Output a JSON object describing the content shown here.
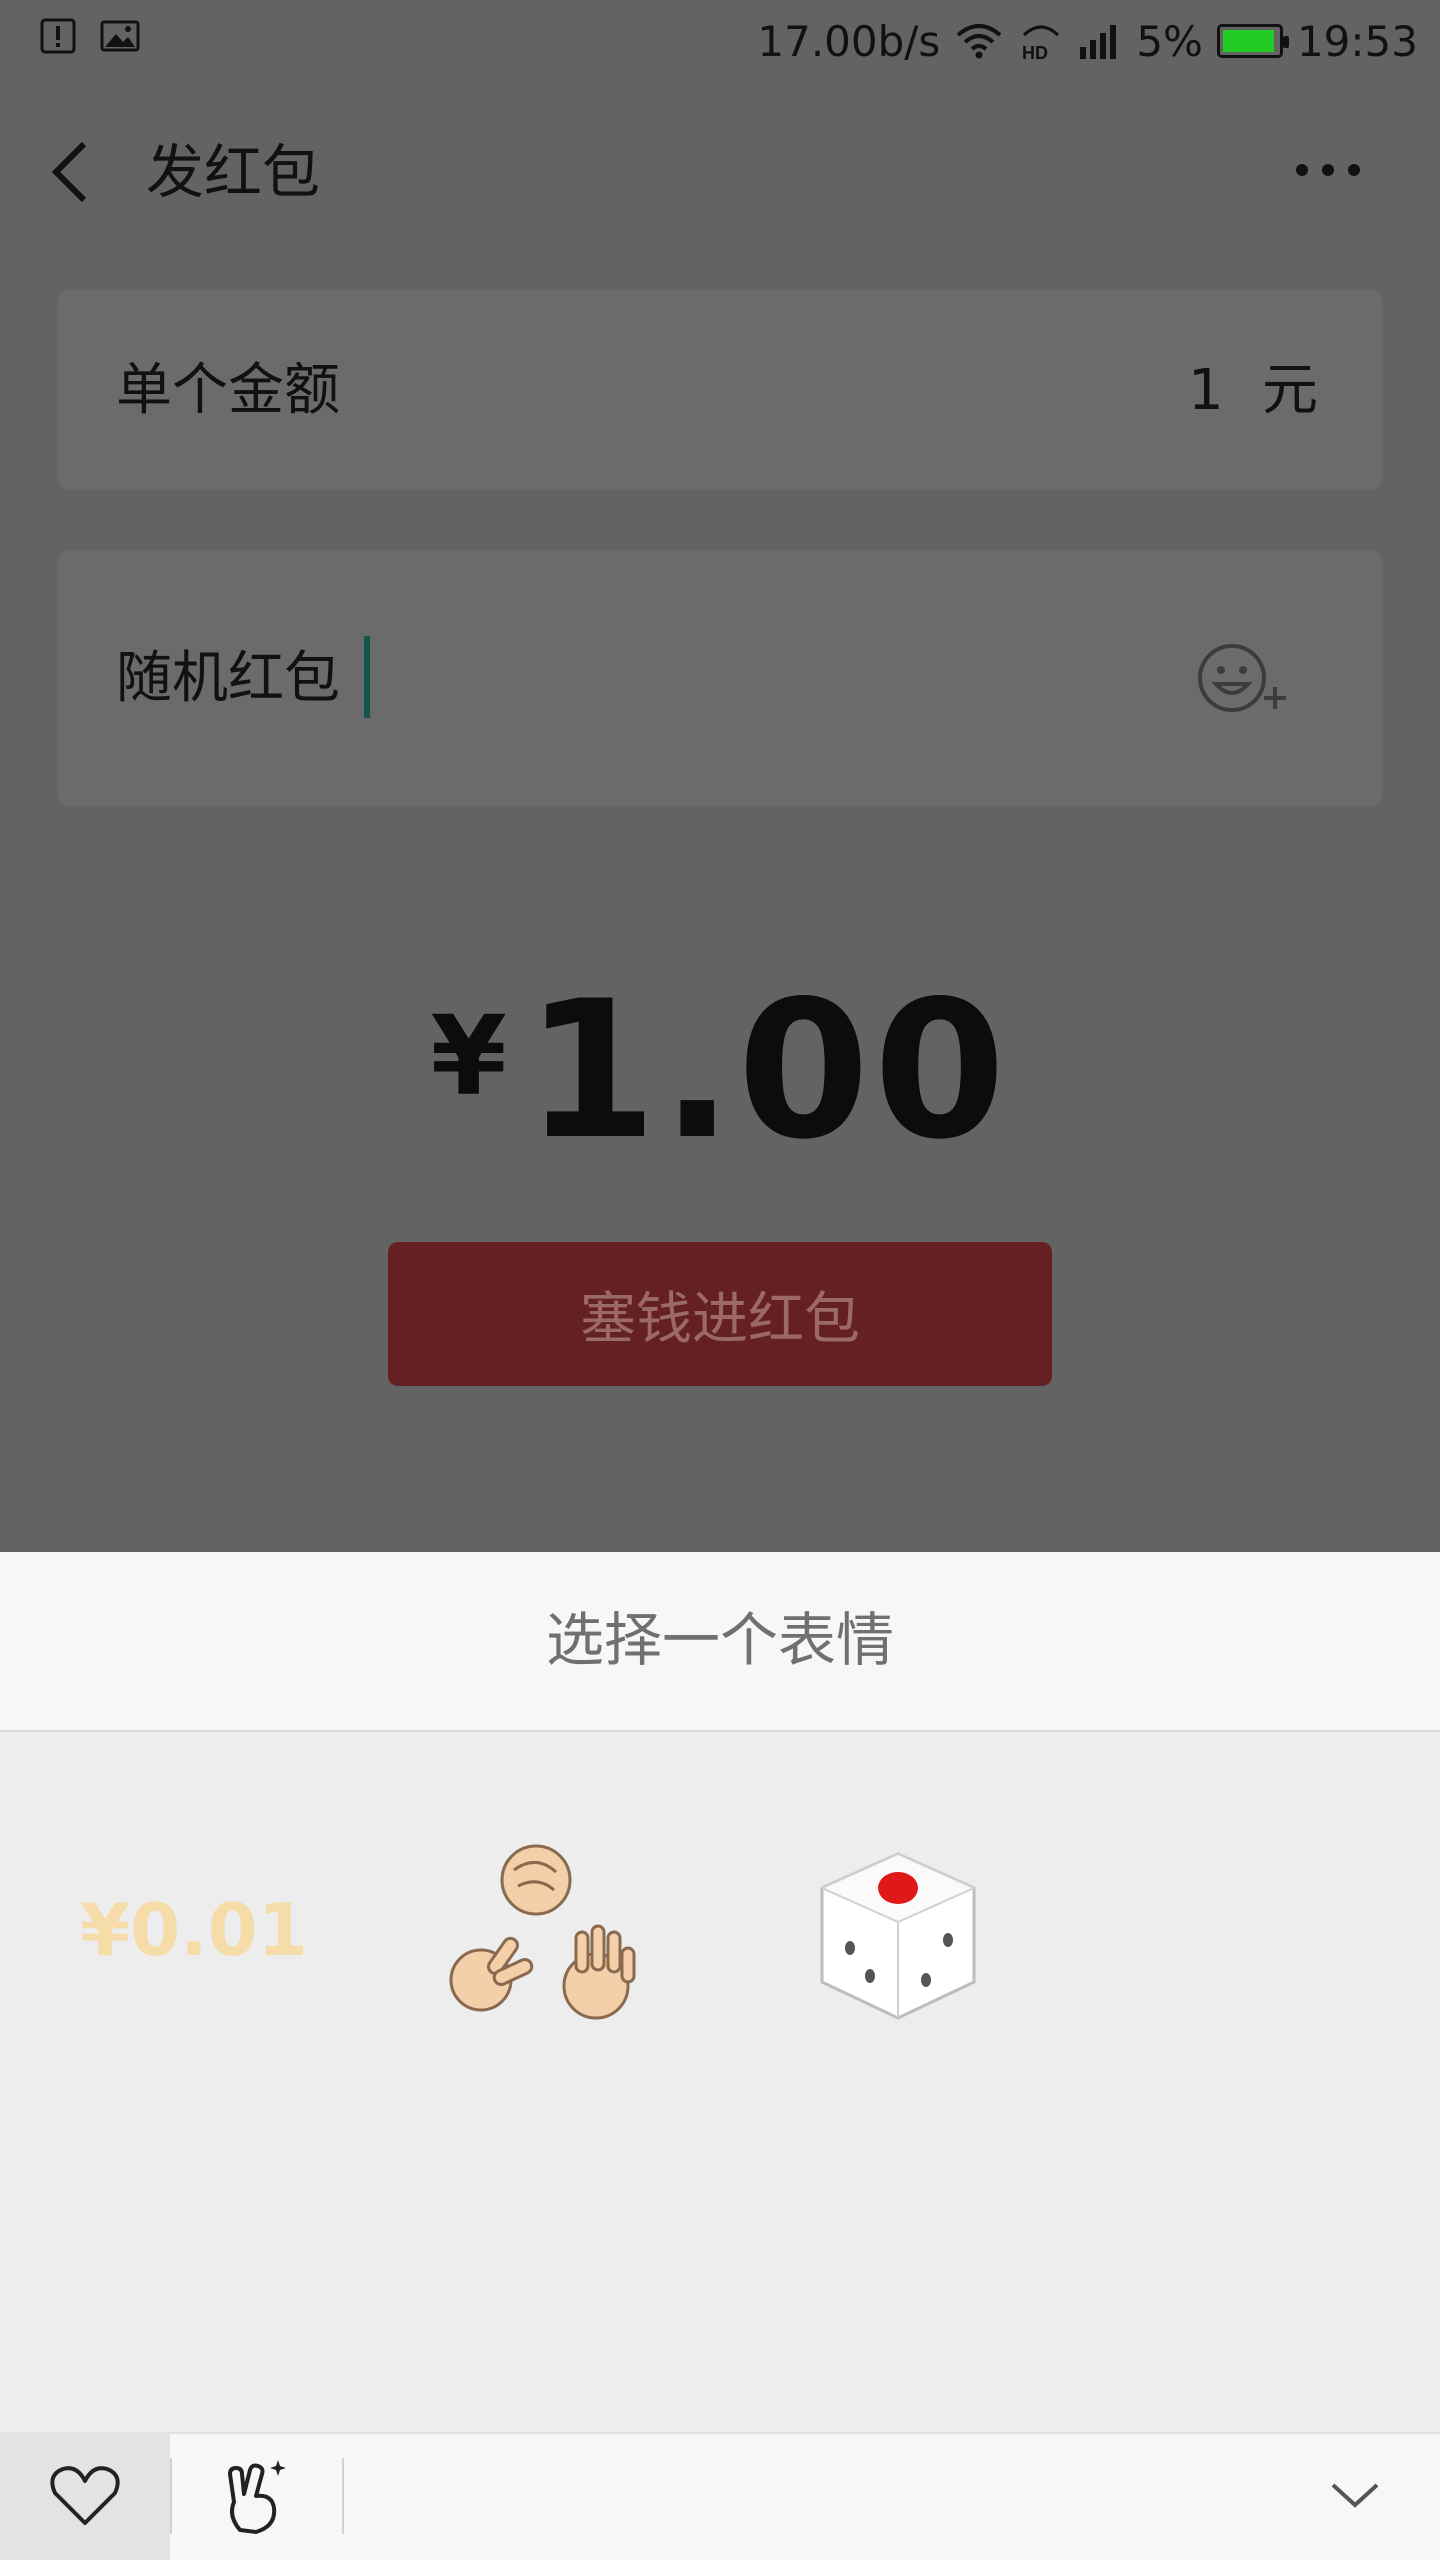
{
  "status_bar": {
    "net_speed": "17.00b/s",
    "battery_percent": "5%",
    "battery_level": 0.05,
    "time": "19:53",
    "icons": [
      "alert-icon",
      "image-icon",
      "wifi-icon",
      "hd-icon",
      "signal-icon",
      "battery-icon"
    ]
  },
  "header": {
    "title": "发红包"
  },
  "amount_card": {
    "label": "单个金额",
    "value": "1",
    "unit": "元"
  },
  "message_card": {
    "text": "随机红包"
  },
  "total": {
    "currency": "¥",
    "amount": "1.00"
  },
  "send_button": {
    "label": "塞钱进红包"
  },
  "emoji_sheet": {
    "title": "选择一个表情",
    "options": [
      {
        "label": "¥0.01",
        "icon": "money-sticker"
      },
      {
        "icon": "rock-paper-scissors-icon"
      },
      {
        "icon": "dice-icon"
      }
    ]
  },
  "tabs": {
    "items": [
      "heart-icon",
      "gesture-icon"
    ],
    "collapse": "chevron-down-icon"
  },
  "colors": {
    "overlay": "#636363",
    "send_button": "#652121",
    "money_label": "#f5dca8",
    "cursor": "#14564e"
  }
}
